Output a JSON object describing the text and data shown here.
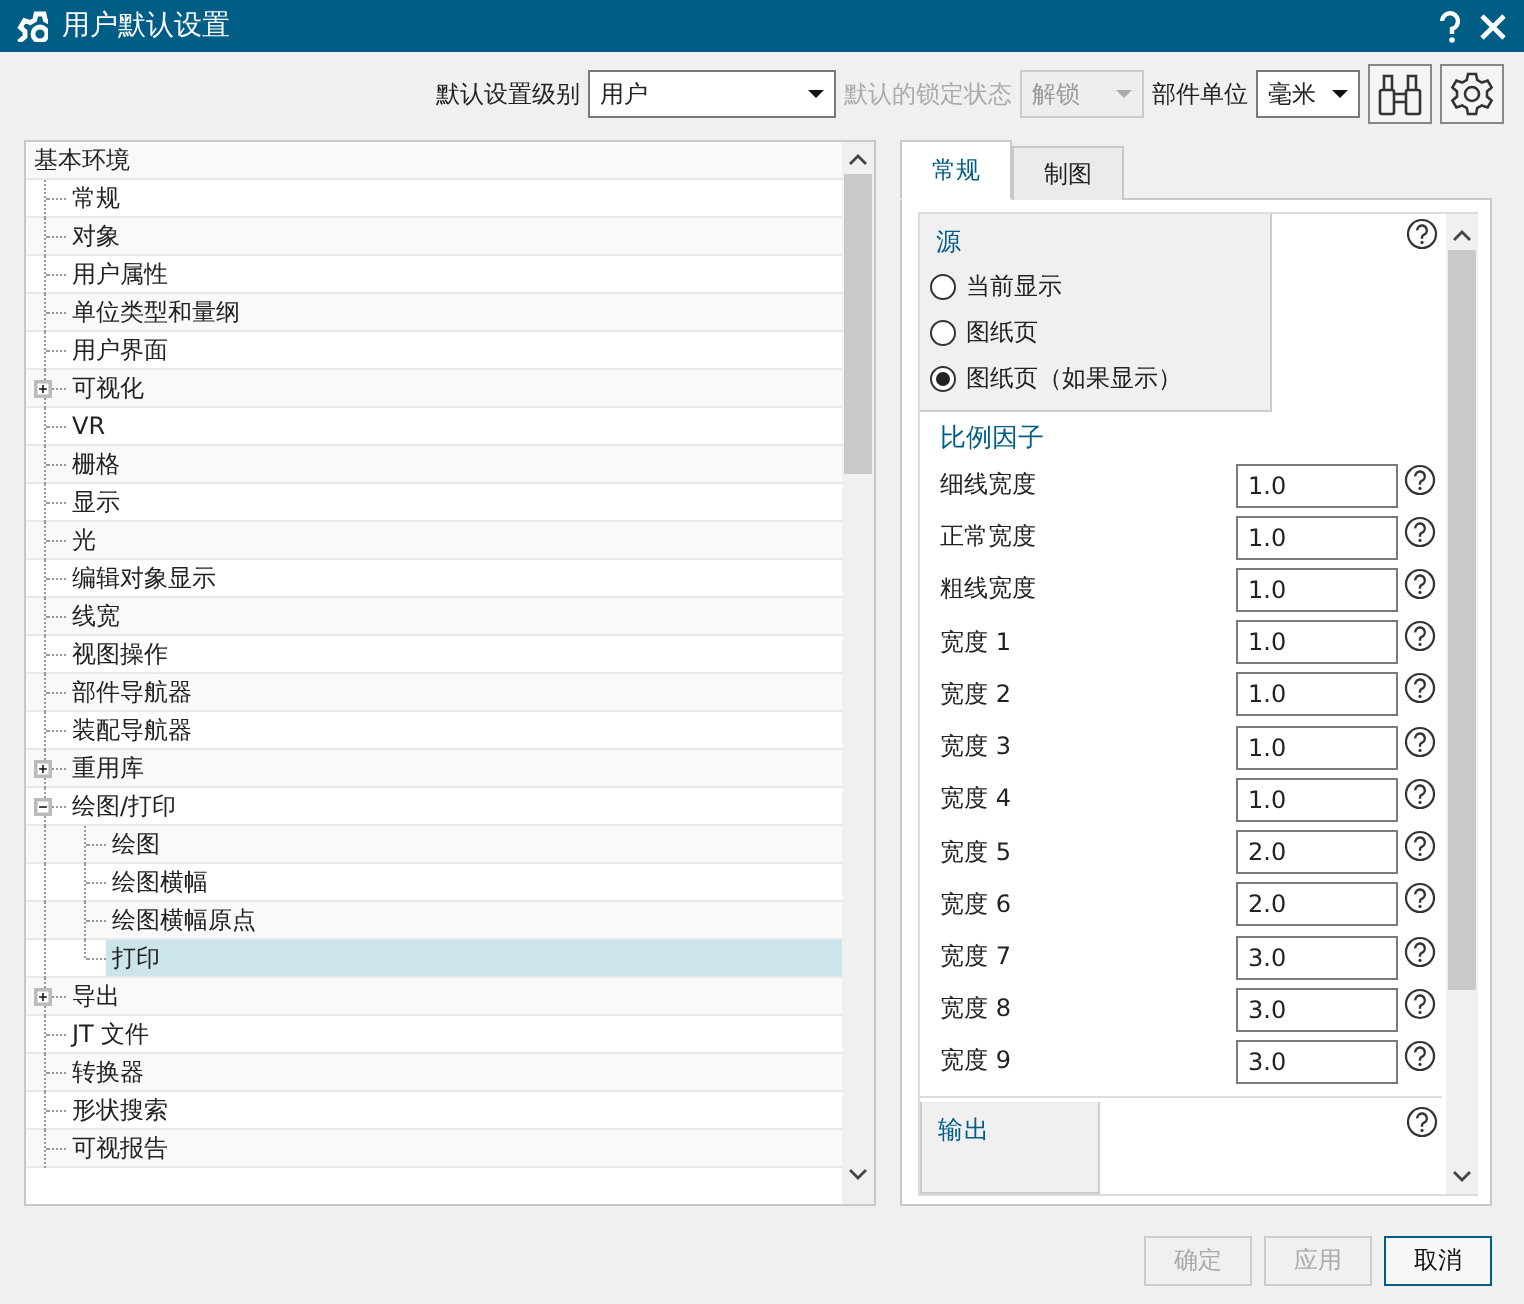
{
  "window": {
    "title": "用户默认设置"
  },
  "toolbar": {
    "fields": [
      {
        "label": "默认设置级别",
        "value": "用户",
        "disabled": false
      },
      {
        "label": "默认的锁定状态",
        "value": "解锁",
        "disabled": true
      },
      {
        "label": "部件单位",
        "value": "毫米",
        "disabled": false
      }
    ]
  },
  "tree": {
    "root": "基本环境",
    "items": [
      {
        "label": "常规",
        "kind": "leaf",
        "selected": false
      },
      {
        "label": "对象",
        "kind": "leaf",
        "selected": false
      },
      {
        "label": "用户属性",
        "kind": "leaf",
        "selected": false
      },
      {
        "label": "单位类型和量纲",
        "kind": "leaf",
        "selected": false
      },
      {
        "label": "用户界面",
        "kind": "leaf",
        "selected": false
      },
      {
        "label": "可视化",
        "kind": "group",
        "expanded": false,
        "selected": false
      },
      {
        "label": "VR",
        "kind": "leaf",
        "selected": false
      },
      {
        "label": "栅格",
        "kind": "leaf",
        "selected": false
      },
      {
        "label": "显示",
        "kind": "leaf",
        "selected": false
      },
      {
        "label": "光",
        "kind": "leaf",
        "selected": false
      },
      {
        "label": "编辑对象显示",
        "kind": "leaf",
        "selected": false
      },
      {
        "label": "线宽",
        "kind": "leaf",
        "selected": false
      },
      {
        "label": "视图操作",
        "kind": "leaf",
        "selected": false
      },
      {
        "label": "部件导航器",
        "kind": "leaf",
        "selected": false
      },
      {
        "label": "装配导航器",
        "kind": "leaf",
        "selected": false
      },
      {
        "label": "重用库",
        "kind": "group",
        "expanded": false,
        "selected": false
      },
      {
        "label": "绘图/打印",
        "kind": "group",
        "expanded": true,
        "selected": false,
        "children": [
          {
            "label": "绘图",
            "kind": "leaf",
            "selected": false
          },
          {
            "label": "绘图横幅",
            "kind": "leaf",
            "selected": false
          },
          {
            "label": "绘图横幅原点",
            "kind": "leaf",
            "selected": false
          },
          {
            "label": "打印",
            "kind": "leaf",
            "selected": true
          }
        ]
      },
      {
        "label": "导出",
        "kind": "group",
        "expanded": false,
        "selected": false
      },
      {
        "label": "JT 文件",
        "kind": "leaf",
        "selected": false
      },
      {
        "label": "转换器",
        "kind": "leaf",
        "selected": false
      },
      {
        "label": "形状搜索",
        "kind": "leaf",
        "selected": false
      },
      {
        "label": "可视报告",
        "kind": "leaf",
        "selected": false
      }
    ]
  },
  "tabs": [
    {
      "label": "常规",
      "selected": true
    },
    {
      "label": "制图",
      "selected": false
    }
  ],
  "source_group": {
    "title": "源",
    "options": [
      {
        "label": "当前显示",
        "selected": false
      },
      {
        "label": "图纸页",
        "selected": false
      },
      {
        "label": "图纸页（如果显示）",
        "selected": true
      }
    ]
  },
  "scale_group": {
    "title": "比例因子",
    "fields": [
      {
        "label": "细线宽度",
        "value": "1.0"
      },
      {
        "label": "正常宽度",
        "value": "1.0"
      },
      {
        "label": "粗线宽度",
        "value": "1.0"
      },
      {
        "label": "宽度 1",
        "value": "1.0"
      },
      {
        "label": "宽度 2",
        "value": "1.0"
      },
      {
        "label": "宽度 3",
        "value": "1.0"
      },
      {
        "label": "宽度 4",
        "value": "1.0"
      },
      {
        "label": "宽度 5",
        "value": "2.0"
      },
      {
        "label": "宽度 6",
        "value": "2.0"
      },
      {
        "label": "宽度 7",
        "value": "3.0"
      },
      {
        "label": "宽度 8",
        "value": "3.0"
      },
      {
        "label": "宽度 9",
        "value": "3.0"
      }
    ]
  },
  "output_group": {
    "title": "输出"
  },
  "buttons": [
    {
      "label": "确定",
      "disabled": true
    },
    {
      "label": "应用",
      "disabled": true
    },
    {
      "label": "取消",
      "disabled": false
    }
  ]
}
